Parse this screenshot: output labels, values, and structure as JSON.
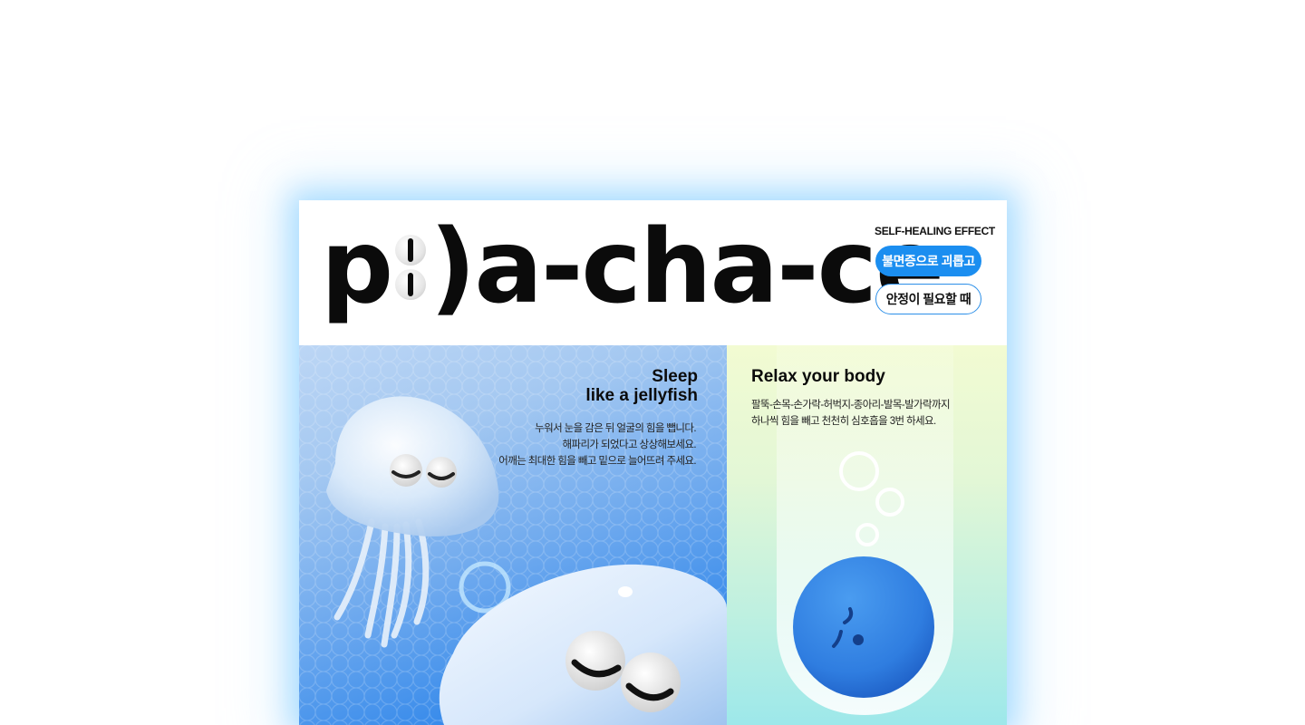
{
  "header": {
    "logo_left": "p",
    "logo_right": ")a-cha-ce",
    "effect_label": "SELF-HEALING EFFECT",
    "buttons": [
      {
        "label": "불면증으로 괴롭고",
        "style": "primary"
      },
      {
        "label": "안정이 필요할 때",
        "style": "outline"
      }
    ]
  },
  "left_panel": {
    "title_line1": "Sleep",
    "title_line2": "like a jellyfish",
    "desc_lines": [
      "누워서 눈을 감은 뒤 얼굴의 힘을 뺍니다.",
      "해파리가 되었다고 상상해보세요.",
      "어깨는 최대한 힘을 빼고 밑으로 늘어뜨려 주세요."
    ]
  },
  "right_panel": {
    "title": "Relax your body",
    "desc_lines": [
      "팔뚝-손목-손가락-허벅지-종아리-발목-발가락까지",
      "하나씩 힘을 빼고 천천히 심호흡을 3번 하세요."
    ]
  },
  "colors": {
    "accent": "#1b8ef0",
    "glow": "#8fd0ff",
    "left_bg_top": "#bcd6f5",
    "left_bg_bottom": "#2a7ee4",
    "right_bg_top": "#f2fbd2",
    "right_bg_bottom": "#9de8ea",
    "ball": "#2f7de0"
  }
}
